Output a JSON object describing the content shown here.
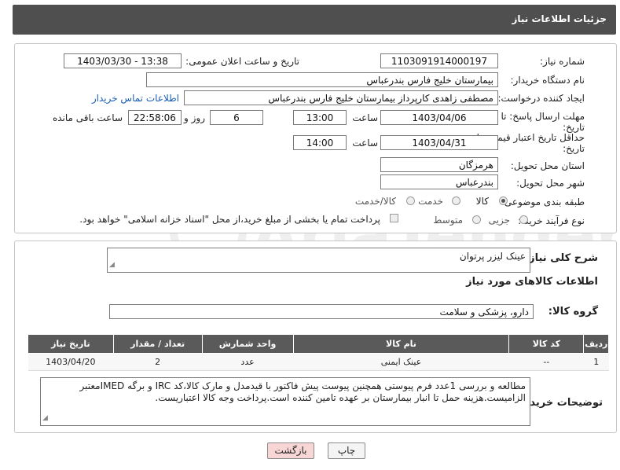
{
  "header": {
    "title": "جزئیات اطلاعات نیاز"
  },
  "form": {
    "need_number_label": "شماره نیاز:",
    "need_number": "1103091914000197",
    "announce_label": "تاریخ و ساعت اعلان عمومی:",
    "announce_value": "1403/03/30 - 13:38",
    "buyer_org_label": "نام دستگاه خریدار:",
    "buyer_org": "بیمارستان خلیج فارس بندرعباس",
    "creator_label": "ایجاد کننده درخواست:",
    "creator": "مصطفی زاهدی کارپرداز بیمارستان خلیج فارس بندرعباس",
    "buyer_contact_link": "اطلاعات تماس خریدار",
    "reply_deadline_label_1": "مهلت ارسال پاسخ: تا",
    "reply_deadline_label_2": "تاریخ:",
    "reply_date": "1403/04/06",
    "time_label": "ساعت",
    "reply_time": "13:00",
    "days_value": "6",
    "days_label": "روز و",
    "remaining_time": "22:58:06",
    "remaining_label": "ساعت باقی مانده",
    "price_validity_label_1": "حداقل تاریخ اعتبار قیمت: تا",
    "price_validity_label_2": "تاریخ:",
    "price_date": "1403/04/31",
    "price_time_label": "ساعت",
    "price_time": "14:00",
    "province_label": "استان محل تحویل:",
    "province": "هرمزگان",
    "city_label": "شهر محل تحویل:",
    "city": "بندرعباس",
    "category_label": "طبقه بندی موضوعی:",
    "category_options": [
      "کالا",
      "خدمت",
      "کالا/خدمت"
    ],
    "category_selected": "کالا",
    "process_label": "نوع فرآیند خرید :",
    "process_options": [
      "جزیی",
      "متوسط"
    ],
    "process_note": "پرداخت تمام یا بخشی از مبلغ خرید،از محل \"اسناد خزانه اسلامی\" خواهد بود."
  },
  "details": {
    "summary_label": "شرح کلی نیاز:",
    "summary": "عینک لیزر پرتوان",
    "goods_info_title": "اطلاعات کالاهای مورد نیاز",
    "group_label": "گروه کالا:",
    "group": "دارو، پزشکی و سلامت",
    "table": {
      "headers": [
        "ردیف",
        "کد کالا",
        "نام کالا",
        "واحد شمارش",
        "تعداد / مقدار",
        "تاریخ نیاز"
      ],
      "rows": [
        [
          "1",
          "--",
          "عینک ایمنی",
          "عدد",
          "2",
          "1403/04/20"
        ]
      ]
    },
    "buyer_notes_label": "توضیحات خریدار:",
    "buyer_notes": "مطالعه و بررسی 1عدد فرم پیوستی همچنین پیوست پیش فاکتور با قیدمدل و مارک کالا،کد IRC و برگه IMEDمعتبر الزامیست.هزینه حمل تا انبار بیمارستان بر عهده تامین کننده است.پرداخت وجه کالا اعتباریست."
  },
  "buttons": {
    "print": "چاپ",
    "back": "بازگشت"
  },
  "watermark": {
    "text": "AriaTender.net"
  },
  "colors": {
    "header_bg": "#4f4f4f",
    "link": "#1a5fb4",
    "back_btn_bg": "#f9d6d6"
  }
}
